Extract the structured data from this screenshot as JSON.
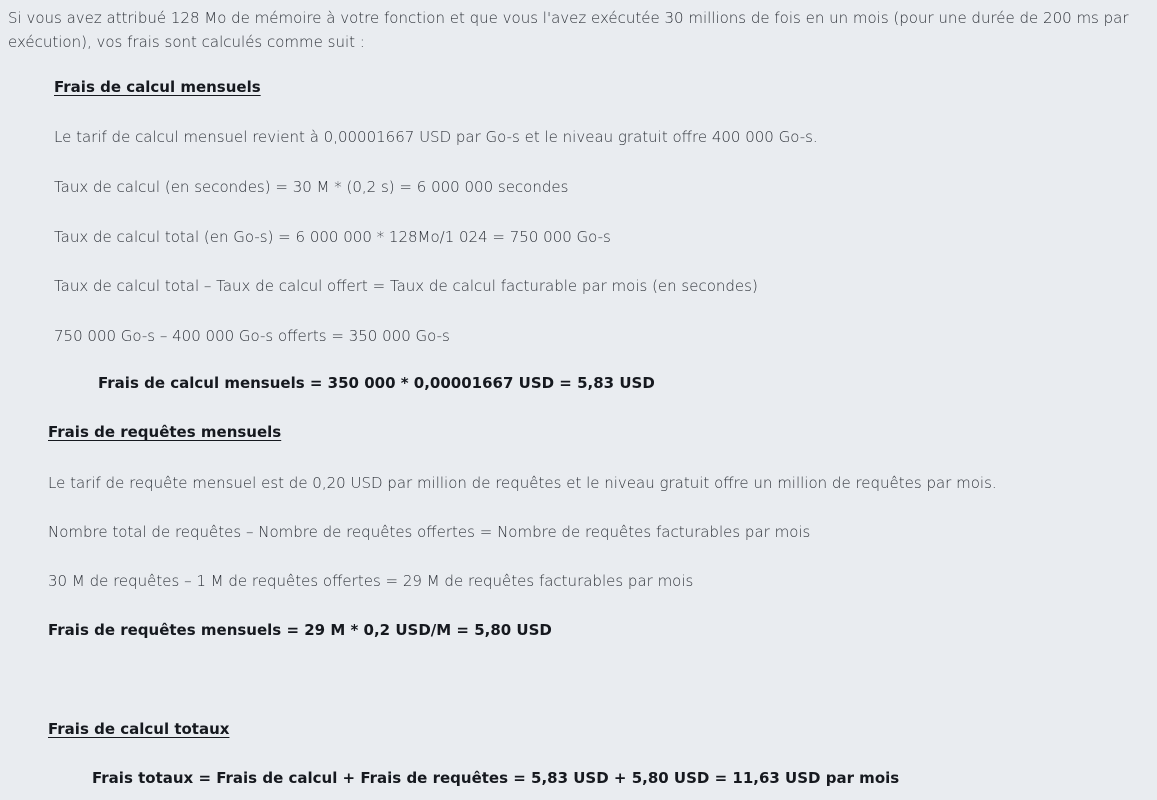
{
  "intro": "Si vous avez attribué 128 Mo de mémoire à votre fonction et que vous l'avez exécutée 30 millions de fois en un mois (pour une durée de 200 ms par exécution), vos frais sont calculés comme suit :",
  "compute": {
    "heading": "Frais de calcul mensuels",
    "rate": "Le tarif de calcul mensuel revient à 0,00001667 USD par Go-s et le niveau gratuit offre 400 000 Go-s.",
    "seconds": "Taux de calcul (en secondes) = 30 M * (0,2 s) = 6 000 000 secondes",
    "total_gbs": "Taux de calcul total (en Go-s) = 6 000 000 * 128Mo/1 024 = 750 000 Go-s",
    "formula": "Taux de calcul total – Taux de calcul offert = Taux de calcul facturable par mois (en secondes)",
    "billable": "750 000 Go-s – 400 000 Go-s offerts = 350 000 Go-s",
    "result": "Frais de calcul mensuels = 350 000 * 0,00001667 USD = 5,83 USD"
  },
  "requests": {
    "heading": "Frais de requêtes mensuels",
    "rate": "Le tarif de requête mensuel est de 0,20 USD par million de requêtes et le niveau gratuit offre un million de requêtes par mois.",
    "formula": "Nombre total de requêtes – Nombre de requêtes offertes = Nombre de requêtes facturables par mois",
    "billable": "30 M de requêtes – 1 M de requêtes offertes = 29 M de requêtes facturables par mois",
    "result": "Frais de requêtes mensuels = 29 M * 0,2 USD/M = 5,80 USD"
  },
  "total": {
    "heading": "Frais de calcul totaux",
    "result": "Frais totaux = Frais de calcul + Frais de requêtes = 5,83 USD + 5,80 USD = 11,63 USD par mois"
  }
}
